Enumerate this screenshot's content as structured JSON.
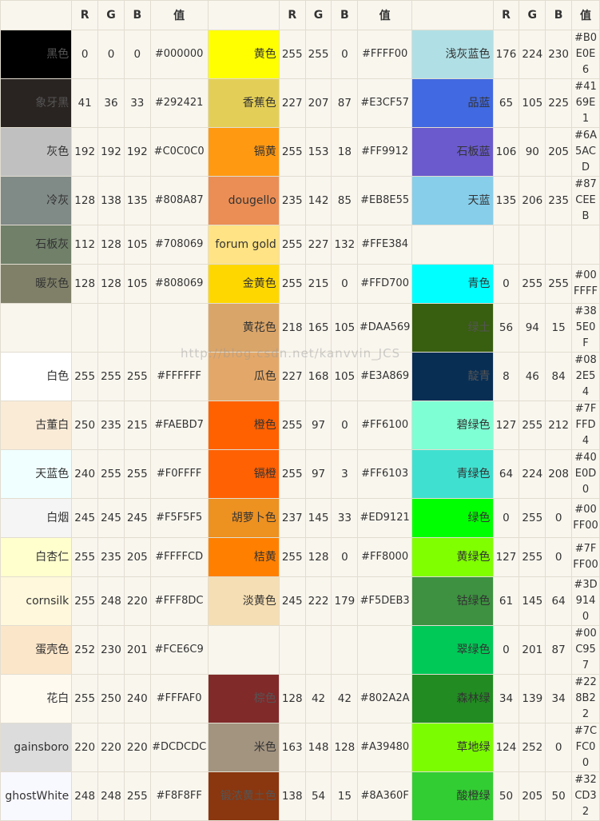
{
  "headers": [
    "R",
    "G",
    "B",
    "值"
  ],
  "watermark": "http://blog.csdn.net/kanvvin_JCS",
  "rows": [
    [
      [
        "黑色",
        "0",
        "0",
        "0",
        "#000000",
        "#000000",
        "#555555"
      ],
      [
        "黄色",
        "255",
        "255",
        "0",
        "#FFFF00",
        "#FFFF00",
        "#333333"
      ],
      [
        "浅灰蓝色",
        "176",
        "224",
        "230",
        "#B0E0E6",
        "#B0E0E6",
        "#333333"
      ]
    ],
    [
      [
        "象牙黑",
        "41",
        "36",
        "33",
        "#292421",
        "#292421",
        "#555555"
      ],
      [
        "香蕉色",
        "227",
        "207",
        "87",
        "#E3CF57",
        "#E3CF57",
        "#333333"
      ],
      [
        "品蓝",
        "65",
        "105",
        "225",
        "#4169E1",
        "#4169E1",
        "#333333"
      ]
    ],
    [
      [
        "灰色",
        "192",
        "192",
        "192",
        "#C0C0C0",
        "#C0C0C0",
        "#333333"
      ],
      [
        "镉黄",
        "255",
        "153",
        "18",
        "#FF9912",
        "#FF9912",
        "#333333"
      ],
      [
        "石板蓝",
        "106",
        "90",
        "205",
        "#6A5ACD",
        "#6A5ACD",
        "#333333"
      ]
    ],
    [
      [
        "冷灰",
        "128",
        "138",
        "135",
        "#808A87",
        "#808A87",
        "#333333"
      ],
      [
        "dougello",
        "235",
        "142",
        "85",
        "#EB8E55",
        "#EB8E55",
        "#333333"
      ],
      [
        "天蓝",
        "135",
        "206",
        "235",
        "#87CEEB",
        "#87CEEB",
        "#333333"
      ]
    ],
    [
      [
        "石板灰",
        "112",
        "128",
        "105",
        "#708069",
        "#708069",
        "#333333"
      ],
      [
        "forum gold",
        "255",
        "227",
        "132",
        "#FFE384",
        "#FFE384",
        "#333333"
      ],
      null
    ],
    [
      [
        "暖灰色",
        "128",
        "128",
        "105",
        "#808069",
        "#808069",
        "#333333"
      ],
      [
        "金黄色",
        "255",
        "215",
        "0",
        "#FFD700",
        "#FFD700",
        "#333333"
      ],
      [
        "青色",
        "0",
        "255",
        "255",
        "#00FFFF",
        "#00FFFF",
        "#333333"
      ]
    ],
    [
      null,
      [
        "黄花色",
        "218",
        "165",
        "105",
        "#DAA569",
        "#DAA569",
        "#333333"
      ],
      [
        "绿土",
        "56",
        "94",
        "15",
        "#385E0F",
        "#385E0F",
        "#555555"
      ]
    ],
    [
      [
        "白色",
        "255",
        "255",
        "255",
        "#FFFFFF",
        "#FFFFFF",
        "#333333"
      ],
      [
        "瓜色",
        "227",
        "168",
        "105",
        "#E3A869",
        "#E3A869",
        "#333333"
      ],
      [
        "靛青",
        "8",
        "46",
        "84",
        "#082E54",
        "#082E54",
        "#555555"
      ]
    ],
    [
      [
        "古董白",
        "250",
        "235",
        "215",
        "#FAEBD7",
        "#FAEBD7",
        "#333333"
      ],
      [
        "橙色",
        "255",
        "97",
        "0",
        "#FF6100",
        "#FF6100",
        "#333333"
      ],
      [
        "碧绿色",
        "127",
        "255",
        "212",
        "#7FFFD4",
        "#7FFFD4",
        "#333333"
      ]
    ],
    [
      [
        "天蓝色",
        "240",
        "255",
        "255",
        "#F0FFFF",
        "#F0FFFF",
        "#333333"
      ],
      [
        "镉橙",
        "255",
        "97",
        "3",
        "#FF6103",
        "#FF6103",
        "#333333"
      ],
      [
        "青绿色",
        "64",
        "224",
        "208",
        "#40E0D0",
        "#40E0D0",
        "#333333"
      ]
    ],
    [
      [
        "白烟",
        "245",
        "245",
        "245",
        "#F5F5F5",
        "#F5F5F5",
        "#333333"
      ],
      [
        "胡萝卜色",
        "237",
        "145",
        "33",
        "#ED9121",
        "#ED9121",
        "#333333"
      ],
      [
        "绿色",
        "0",
        "255",
        "0",
        "#00FF00",
        "#00FF00",
        "#333333"
      ]
    ],
    [
      [
        "白杏仁",
        "255",
        "235",
        "205",
        "#FFFFCD",
        "#FFFFCD",
        "#333333"
      ],
      [
        "桔黄",
        "255",
        "128",
        "0",
        "#FF8000",
        "#FF8000",
        "#333333"
      ],
      [
        "黄绿色",
        "127",
        "255",
        "0",
        "#7FFF00",
        "#7FFF00",
        "#333333"
      ]
    ],
    [
      [
        "cornsilk",
        "255",
        "248",
        "220",
        "#FFF8DC",
        "#FFF8DC",
        "#333333"
      ],
      [
        "淡黄色",
        "245",
        "222",
        "179",
        "#F5DEB3",
        "#F5DEB3",
        "#333333"
      ],
      [
        "钴绿色",
        "61",
        "145",
        "64",
        "#3D9140",
        "#3D9140",
        "#333333"
      ]
    ],
    [
      [
        "蛋壳色",
        "252",
        "230",
        "201",
        "#FCE6C9",
        "#FCE6C9",
        "#333333"
      ],
      null,
      [
        "翠绿色",
        "0",
        "201",
        "87",
        "#00C957",
        "#00C957",
        "#333333"
      ]
    ],
    [
      [
        "花白",
        "255",
        "250",
        "240",
        "#FFFAF0",
        "#FFFAF0",
        "#333333"
      ],
      [
        "棕色",
        "128",
        "42",
        "42",
        "#802A2A",
        "#802A2A",
        "#555555"
      ],
      [
        "森林绿",
        "34",
        "139",
        "34",
        "#228B22",
        "#228B22",
        "#333333"
      ]
    ],
    [
      [
        "gainsboro",
        "220",
        "220",
        "220",
        "#DCDCDC",
        "#DCDCDC",
        "#333333"
      ],
      [
        "米色",
        "163",
        "148",
        "128",
        "#A39480",
        "#A39480",
        "#333333"
      ],
      [
        "草地绿",
        "124",
        "252",
        "0",
        "#7CFC00",
        "#7CFC00",
        "#333333"
      ]
    ],
    [
      [
        "ghostWhite",
        "248",
        "248",
        "255",
        "#F8F8FF",
        "#F8F8FF",
        "#333333"
      ],
      [
        "锻浓黄土色",
        "138",
        "54",
        "15",
        "#8A360F",
        "#8A360F",
        "#555555"
      ],
      [
        "酸橙绿",
        "50",
        "205",
        "50",
        "#32CD32",
        "#32CD32",
        "#333333"
      ]
    ]
  ]
}
